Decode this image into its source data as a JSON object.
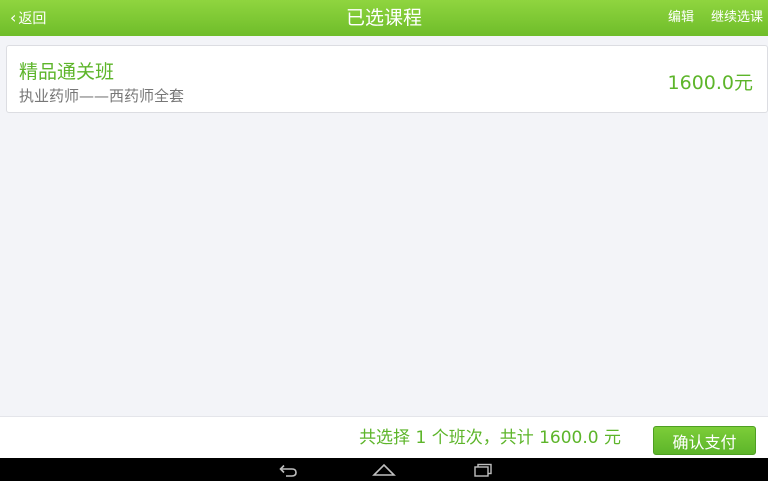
{
  "header": {
    "back_label": "返回",
    "title": "已选课程",
    "edit_label": "编辑",
    "continue_label": "继续选课"
  },
  "course": {
    "name": "精品通关班",
    "description": "执业药师——西药师全套",
    "price": "1600.0元"
  },
  "footer": {
    "summary_prefix": "共选择 ",
    "class_count": "1",
    "summary_middle": " 个班次，共计 ",
    "total": "1600.0",
    "currency": " 元",
    "confirm_label": "确认支付"
  },
  "colors": {
    "header_green": "#7cc832",
    "accent_green": "#5db52a",
    "background": "#f3f4f8"
  },
  "system_nav": {
    "icons": [
      "back-icon",
      "home-icon",
      "recent-apps-icon"
    ]
  }
}
